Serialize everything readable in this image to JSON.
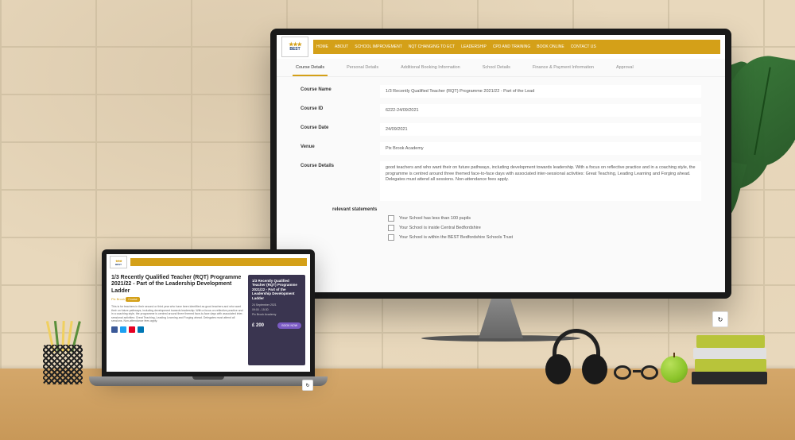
{
  "logo": {
    "text": "BEST",
    "subtext": "BEDFORDSHIRE"
  },
  "nav": {
    "items": [
      "HOME",
      "ABOUT",
      "SCHOOL IMPROVEMENT",
      "NQT CHANGING TO ECT",
      "LEADERSHIP",
      "CPD AND TRAINING",
      "BOOK ONLINE",
      "CONTACT US"
    ]
  },
  "tabs": {
    "items": [
      "Course Details",
      "Personal Details",
      "Additional Booking Information",
      "School Details",
      "Finance & Payment Information",
      "Approval"
    ],
    "active_index": 0
  },
  "form": {
    "course_name": {
      "label": "Course Name",
      "value": "1/3 Recently Qualified Teacher (RQT) Programme 2021/22 - Part of the Lead"
    },
    "course_id": {
      "label": "Course ID",
      "value": "6222-24/09/2021"
    },
    "course_date": {
      "label": "Course Date",
      "value": "24/09/2021"
    },
    "venue": {
      "label": "Venue",
      "value": "Pix Brook Academy"
    },
    "course_details": {
      "label": "Course Details",
      "value": "good teachers and who want their on future pathways, including development towards leadership. With a focus on reflective practice and in a coaching style, the programme is centred around three themed face-to-face days with associated inter-sessional activities: Great Teaching, Leading Learning and Forging ahead.\n\nDelegates must attend all sessions. Non-attendance fees apply."
    },
    "statements_label": "relevant statements",
    "statements": [
      "Your School has less than 100 pupils",
      "Your School is inside Central Bedfordshire",
      "Your School is within the BEST Bedfordshire Schools Trust"
    ]
  },
  "laptop": {
    "title": "1/3 Recently Qualified Teacher (RQT) Programme 2021/22 - Part of the Leadership Development Ladder",
    "meta_location": "Pix Brook",
    "badge": "Course",
    "description": "This is for teachers in their second or third year who have been identified as good teachers and who want their on future pathways, including development towards leadership. With a focus on reflective practice and in a coaching style, the programme is centred around three themed face-to-face days with associated inter-sessional activities: Great Teaching, Leading Learning and Forging ahead.\n\nDelegates must attend all sessions. Non-attendance fees apply.",
    "sidebar": {
      "title": "1/3 Recently Qualified Teacher (RQT) Programme 2021/22 - Part of the Leadership Development Ladder",
      "items": [
        "24 September 2021",
        "09:00 - 15:30",
        "Pix Brook Academy"
      ],
      "price": "£ 200",
      "button": "BOOK NOW"
    }
  },
  "recaptcha": {
    "icon": "↻"
  }
}
